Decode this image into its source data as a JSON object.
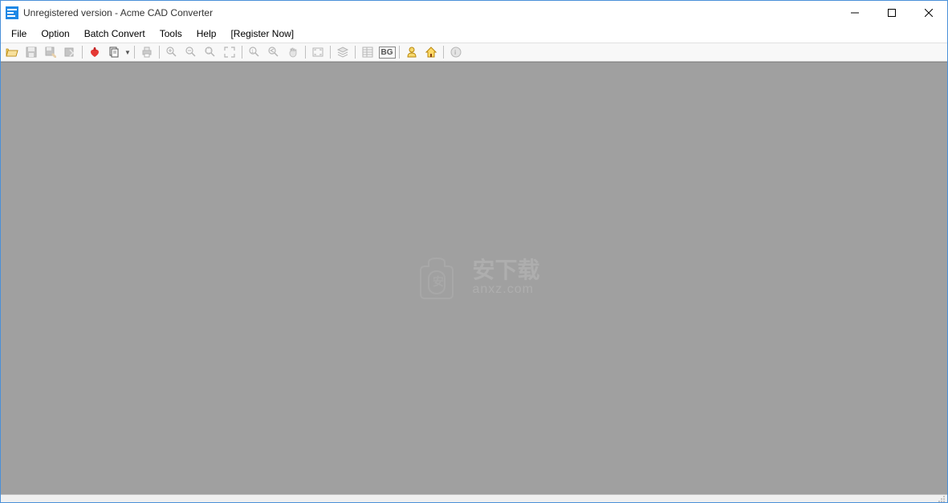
{
  "titlebar": {
    "title": "Unregistered version - Acme CAD Converter"
  },
  "menu": {
    "items": [
      "File",
      "Option",
      "Batch Convert",
      "Tools",
      "Help",
      "[Register Now]"
    ]
  },
  "toolbar": {
    "bg_label": "BG",
    "icons": {
      "open": "open-icon",
      "save": "save-icon",
      "save_as": "save-as-icon",
      "export": "export-icon",
      "pdf": "pdf-icon",
      "copy": "copy-icon",
      "print": "print-icon",
      "zoom_in": "zoom-in-icon",
      "zoom_out": "zoom-out-icon",
      "zoom_window": "zoom-window-icon",
      "zoom_extents": "zoom-extents-icon",
      "zoom_real": "zoom-real-icon",
      "pan": "pan-icon",
      "full_screen": "full-screen-icon",
      "layers": "layers-icon",
      "properties": "properties-icon",
      "background": "background-icon",
      "person": "user-icon",
      "home": "home-icon",
      "help": "help-icon"
    }
  },
  "watermark": {
    "cn": "安下载",
    "en": "anxz.com"
  }
}
